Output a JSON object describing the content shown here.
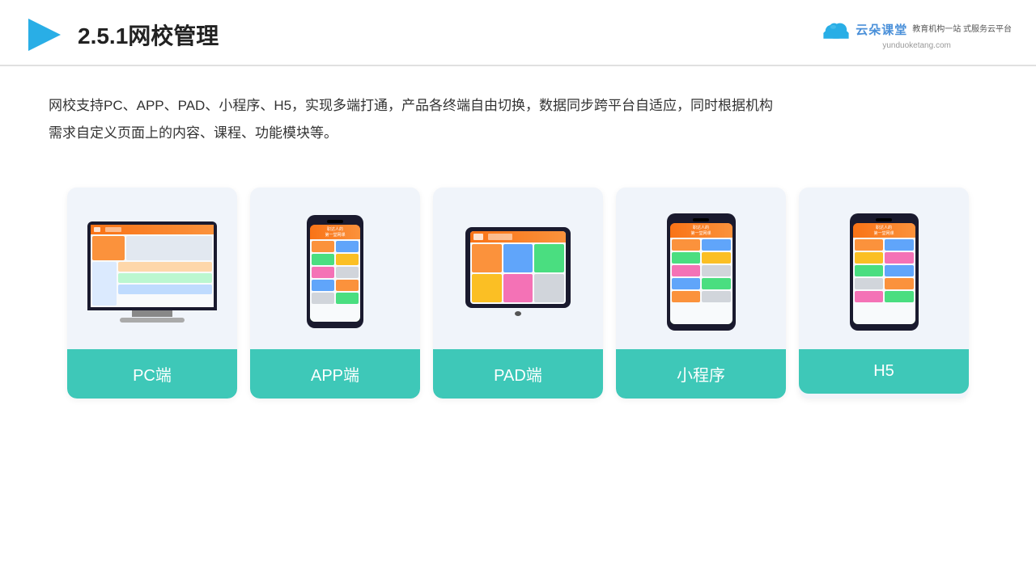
{
  "header": {
    "title": "2.5.1网校管理",
    "logo": {
      "brand": "云朵课堂",
      "url": "yunduoketang.com",
      "tagline": "教育机构一站\n式服务云平台"
    }
  },
  "description": {
    "text": "网校支持PC、APP、PAD、小程序、H5，实现多端打通，产品各终端自由切换，数据同步跨平台自适应，同时根据机构\n需求自定义页面上的内容、课程、功能模块等。"
  },
  "cards": [
    {
      "id": "pc",
      "label": "PC端"
    },
    {
      "id": "app",
      "label": "APP端"
    },
    {
      "id": "pad",
      "label": "PAD端"
    },
    {
      "id": "miniapp",
      "label": "小程序"
    },
    {
      "id": "h5",
      "label": "H5"
    }
  ],
  "colors": {
    "accent": "#3ec8b8",
    "headerBorder": "#e0e0e0",
    "logoBlue": "#4a90d9"
  }
}
